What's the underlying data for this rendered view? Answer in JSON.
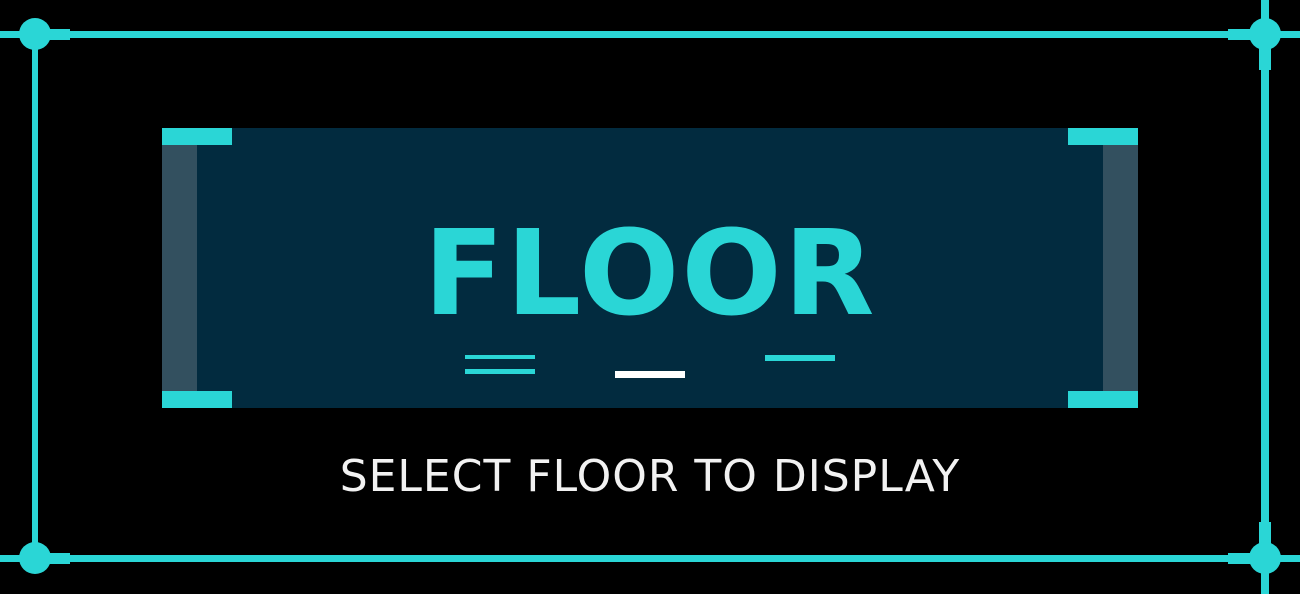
{
  "selector": {
    "title": "FLOOR",
    "subtitle": "SELECT FLOOR TO DISPLAY",
    "indicators": [
      {
        "name": "previous-floor-indicator",
        "style": "double"
      },
      {
        "name": "current-floor-indicator",
        "style": "single",
        "active": true
      },
      {
        "name": "next-floor-indicator",
        "style": "single"
      }
    ]
  },
  "colors": {
    "background": "#000000",
    "accent": "#2ad6d6",
    "panel": "#022b3f",
    "bracket_side": "#33505f",
    "active_indicator": "#ffffff",
    "subtitle_text": "#f2f2f2"
  }
}
